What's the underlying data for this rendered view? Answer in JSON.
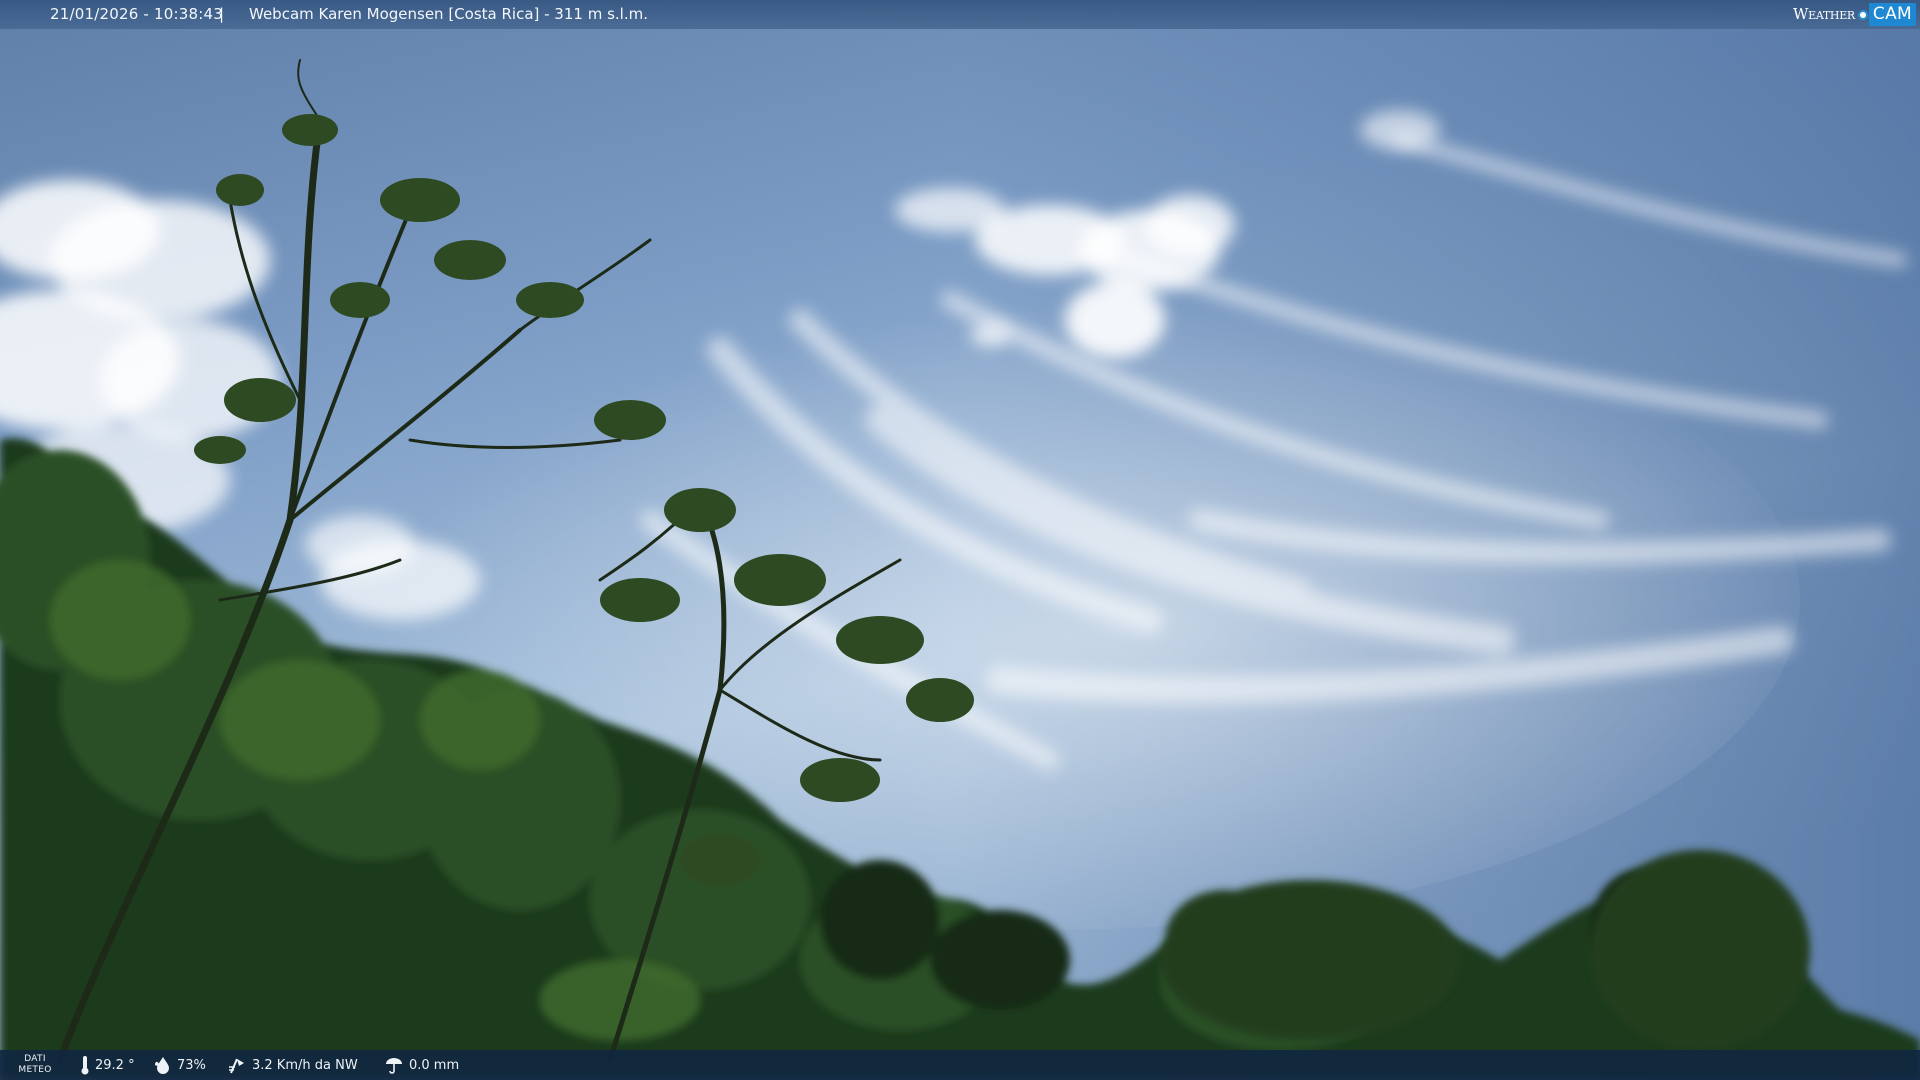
{
  "header": {
    "timestamp": "21/01/2026 - 10:38:43",
    "separator": "|",
    "title": "Webcam Karen Mogensen [Costa Rica] - 311 m s.l.m."
  },
  "brand": {
    "word": "Weather",
    "cam": "CAM",
    "accent_color": "#1e88d2"
  },
  "footer": {
    "label_line1": "DATI",
    "label_line2": "METEO",
    "temperature": "29.2 °",
    "humidity": "73%",
    "wind": "3.2 Km/h da NW",
    "rain": "0.0 mm"
  },
  "icons": {
    "temperature": "thermometer-icon",
    "humidity": "droplet-icon",
    "wind": "wind-icon",
    "rain": "rain-icon"
  }
}
